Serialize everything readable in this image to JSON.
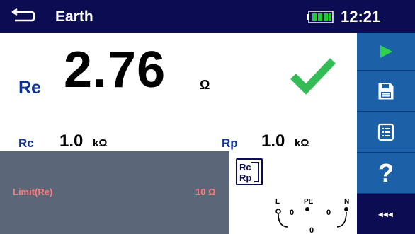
{
  "header": {
    "title": "Earth",
    "time": "12:21"
  },
  "result": {
    "main_label": "Re",
    "main_value": "2.76",
    "main_unit": "Ω",
    "status": "pass",
    "sub_results": [
      {
        "label": "Rc",
        "value": "1.0",
        "unit": "kΩ"
      },
      {
        "label": "Rp",
        "value": "1.0",
        "unit": "kΩ"
      }
    ]
  },
  "limit": {
    "label": "Limit(Re)",
    "value": "10 Ω"
  },
  "rcrp_icon": {
    "top": "Rc",
    "bottom": "Rp"
  },
  "terminals": {
    "labels": [
      "L",
      "PE",
      "N"
    ],
    "values": [
      "0",
      "0",
      "0"
    ]
  },
  "sidebar": {
    "help_label": "?",
    "more_label": "◂◂◂"
  },
  "colors": {
    "header_bg": "#0c0c52",
    "sidebar_bg": "#1c60a8",
    "label_blue": "#0e3296",
    "pass_green": "#33bb55",
    "limit_panel": "#5b6678",
    "limit_text": "#ff7a7a",
    "start_green": "#2fd14a"
  }
}
